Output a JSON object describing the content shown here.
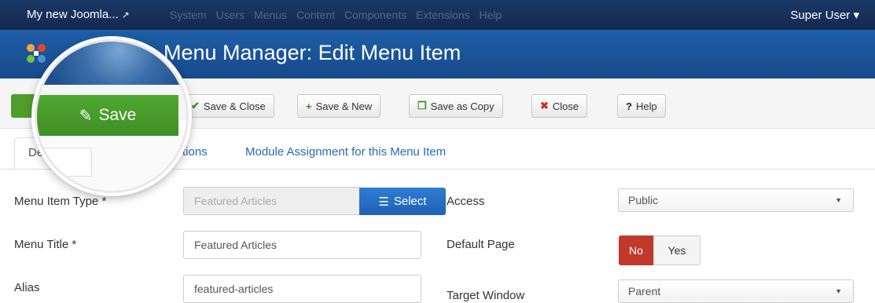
{
  "navbar": {
    "site_name": "My new Joomla...",
    "site_icon": "external-link-icon",
    "menu": [
      "System",
      "Users",
      "Menus",
      "Content",
      "Components",
      "Extensions",
      "Help"
    ],
    "user": "Super User",
    "user_caret": "▾"
  },
  "header": {
    "title": "Menu Manager: Edit Menu Item"
  },
  "toolbar": {
    "save": "Save",
    "save_close": "Save & Close",
    "save_new": "Save & New",
    "save_copy": "Save as Copy",
    "close": "Close",
    "help": "Help"
  },
  "tabs": {
    "details": "Deta",
    "options": "Options",
    "module_assignment": "Module Assignment for this Menu Item"
  },
  "form": {
    "menu_item_type_label": "Menu Item Type *",
    "menu_item_type_value": "Featured Articles",
    "select_label": "Select",
    "menu_title_label": "Menu Title *",
    "menu_title_value": "Featured Articles",
    "alias_label": "Alias",
    "alias_value": "featured-articles",
    "access_label": "Access",
    "access_value": "Public",
    "default_page_label": "Default Page",
    "default_page_no": "No",
    "default_page_yes": "Yes",
    "default_page_selected": "No",
    "target_window_label": "Target Window",
    "target_window_value": "Parent"
  },
  "colors": {
    "navbar": "#1a3867",
    "header": "#1e5fa8",
    "save_green": "#4fa832",
    "toggle_no_red": "#c0392b",
    "select_blue": "#2e7dd2"
  }
}
